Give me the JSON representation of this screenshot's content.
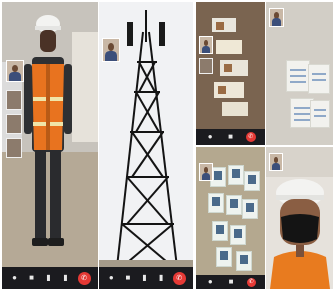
{
  "collage": {
    "background": "#ffffff",
    "panels": [
      {
        "id": "worker-call",
        "subject": "worker in hard hat and orange safety vest",
        "controls": [
          "microphone-icon",
          "camera-icon",
          "switch-camera-icon",
          "end-call-icon"
        ]
      },
      {
        "id": "tower-call",
        "subject": "steel lattice telecom tower against sky",
        "controls": [
          "microphone-icon",
          "camera-icon",
          "switch-camera-icon",
          "end-call-icon"
        ]
      },
      {
        "id": "documents-call",
        "subject": "cards and papers laid out on a floor",
        "controls": [
          "microphone-icon",
          "camera-icon",
          "end-call-icon"
        ]
      },
      {
        "id": "papers-call",
        "subject": "stack of printed forms on a wall"
      },
      {
        "id": "id-cards-call",
        "subject": "id cards arranged on a board",
        "controls": [
          "microphone-icon",
          "camera-icon",
          "end-call-icon"
        ]
      },
      {
        "id": "face-call",
        "subject": "person wearing black face mask and hard hat"
      }
    ]
  },
  "colors": {
    "end_call": "#e53935",
    "control_bar": "#1b1b1f",
    "vest_orange": "#e8731f",
    "hard_hat": "#f3f3f1"
  }
}
